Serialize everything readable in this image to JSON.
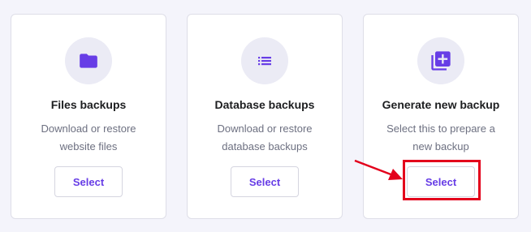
{
  "cards": [
    {
      "title": "Files backups",
      "description_line1": "Download or restore",
      "description_line2": "website files",
      "button_label": "Select",
      "icon": "folder-icon"
    },
    {
      "title": "Database backups",
      "description_line1": "Download or restore",
      "description_line2": "database backups",
      "button_label": "Select",
      "icon": "list-icon"
    },
    {
      "title": "Generate new backup",
      "description_line1": "Select this to prepare a",
      "description_line2": "new backup",
      "button_label": "Select",
      "icon": "add-copy-icon"
    }
  ],
  "colors": {
    "accent": "#673de6",
    "highlight": "#e3001b",
    "icon_bg": "#ebebf5"
  }
}
